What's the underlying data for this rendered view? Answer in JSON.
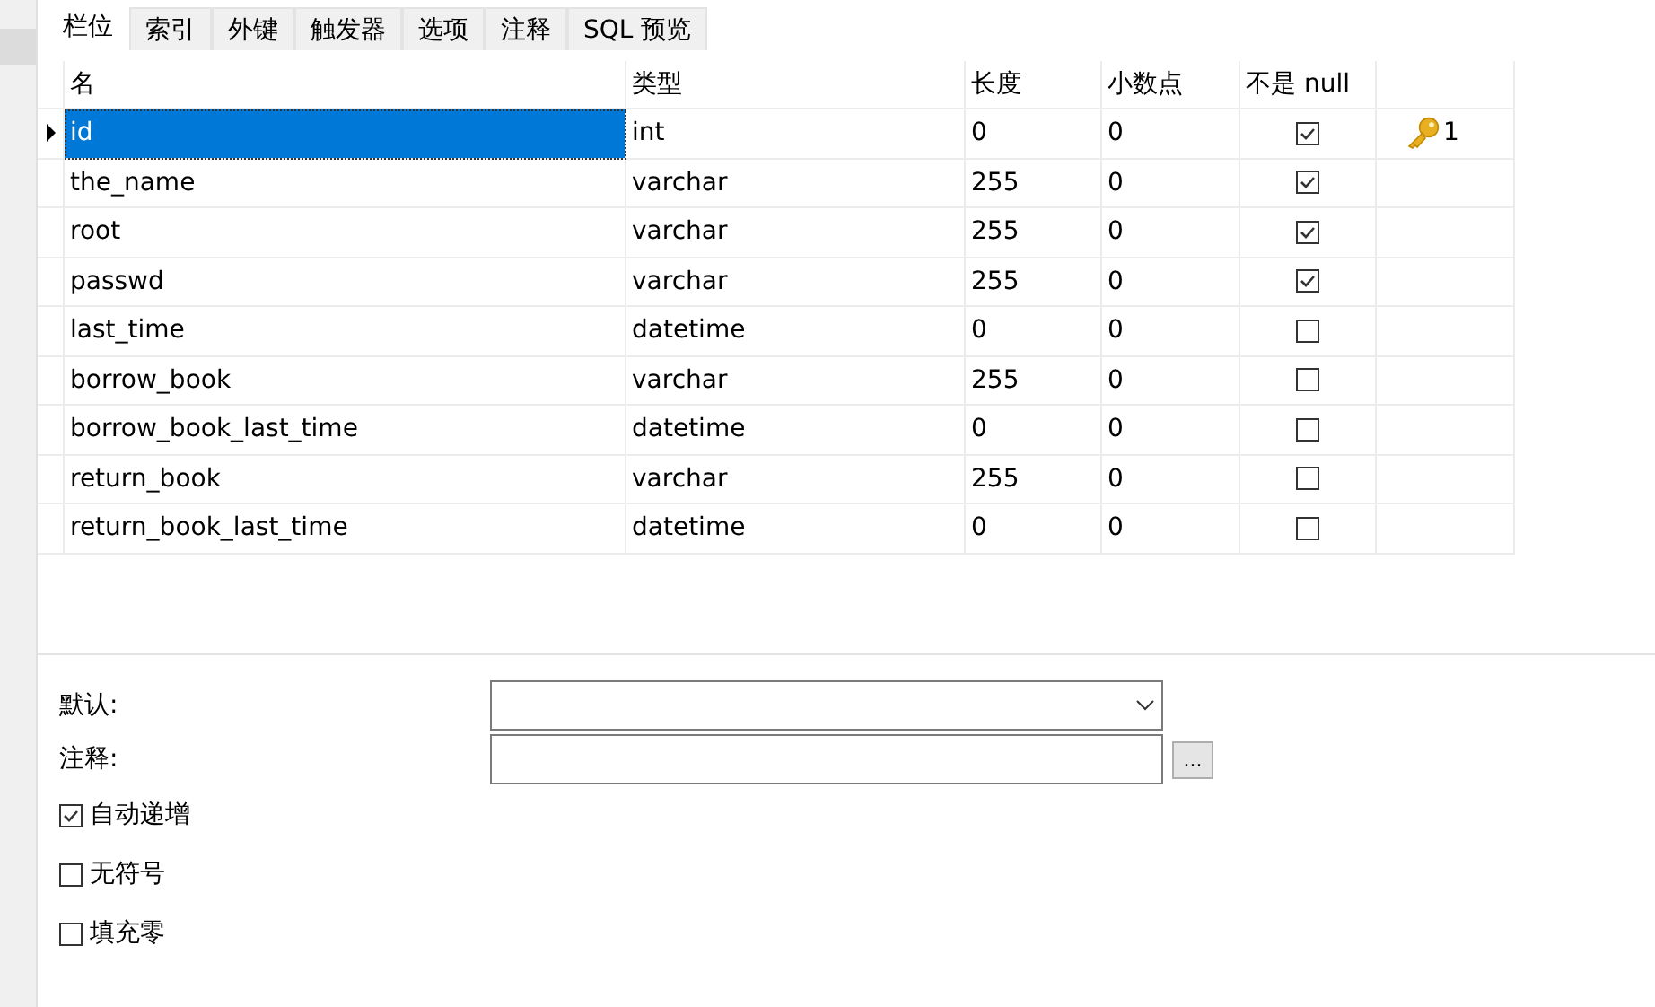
{
  "tabs": [
    {
      "label": "栏位",
      "selected": true
    },
    {
      "label": "索引",
      "selected": false
    },
    {
      "label": "外键",
      "selected": false
    },
    {
      "label": "触发器",
      "selected": false
    },
    {
      "label": "选项",
      "selected": false
    },
    {
      "label": "注释",
      "selected": false
    },
    {
      "label": "SQL 预览",
      "selected": false
    }
  ],
  "table": {
    "columns": [
      "名",
      "类型",
      "长度",
      "小数点",
      "不是 null"
    ],
    "rows": [
      {
        "name": "id",
        "type": "int",
        "length": "0",
        "decimals": "0",
        "not_null": true,
        "key": "1",
        "selected": true
      },
      {
        "name": "the_name",
        "type": "varchar",
        "length": "255",
        "decimals": "0",
        "not_null": true,
        "selected": false
      },
      {
        "name": "root",
        "type": "varchar",
        "length": "255",
        "decimals": "0",
        "not_null": true,
        "selected": false
      },
      {
        "name": "passwd",
        "type": "varchar",
        "length": "255",
        "decimals": "0",
        "not_null": true,
        "selected": false
      },
      {
        "name": "last_time",
        "type": "datetime",
        "length": "0",
        "decimals": "0",
        "not_null": false,
        "selected": false
      },
      {
        "name": "borrow_book",
        "type": "varchar",
        "length": "255",
        "decimals": "0",
        "not_null": false,
        "selected": false
      },
      {
        "name": "borrow_book_last_time",
        "type": "datetime",
        "length": "0",
        "decimals": "0",
        "not_null": false,
        "selected": false
      },
      {
        "name": "return_book",
        "type": "varchar",
        "length": "255",
        "decimals": "0",
        "not_null": false,
        "selected": false
      },
      {
        "name": "return_book_last_time",
        "type": "datetime",
        "length": "0",
        "decimals": "0",
        "not_null": false,
        "selected": false
      }
    ]
  },
  "properties": {
    "default_label": "默认:",
    "comment_label": "注释:",
    "browse_button": "...",
    "options": [
      {
        "label": "自动递增",
        "checked": true
      },
      {
        "label": "无符号",
        "checked": false
      },
      {
        "label": "填充零",
        "checked": false
      }
    ]
  }
}
